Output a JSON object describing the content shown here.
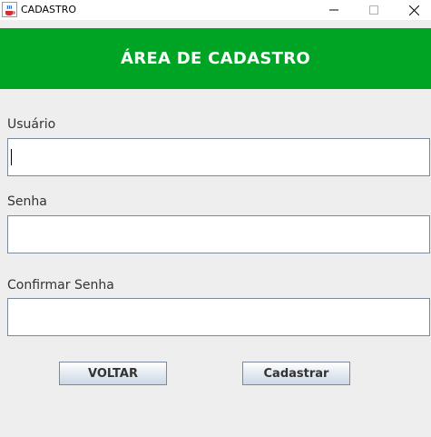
{
  "window": {
    "title": "CADASTRO",
    "icon": "java-coffee-icon",
    "controls": [
      "minimize-icon",
      "maximize-icon",
      "close-icon"
    ]
  },
  "header": {
    "title": "ÁREA DE CADASTRO",
    "background_color": "#00a424",
    "text_color": "#ffffff"
  },
  "form": {
    "username": {
      "label": "Usuário",
      "value": ""
    },
    "password": {
      "label": "Senha",
      "value": ""
    },
    "confirm_password": {
      "label": "Confirmar Senha",
      "value": ""
    }
  },
  "buttons": {
    "back_label": "VOLTAR",
    "register_label": "Cadastrar"
  }
}
